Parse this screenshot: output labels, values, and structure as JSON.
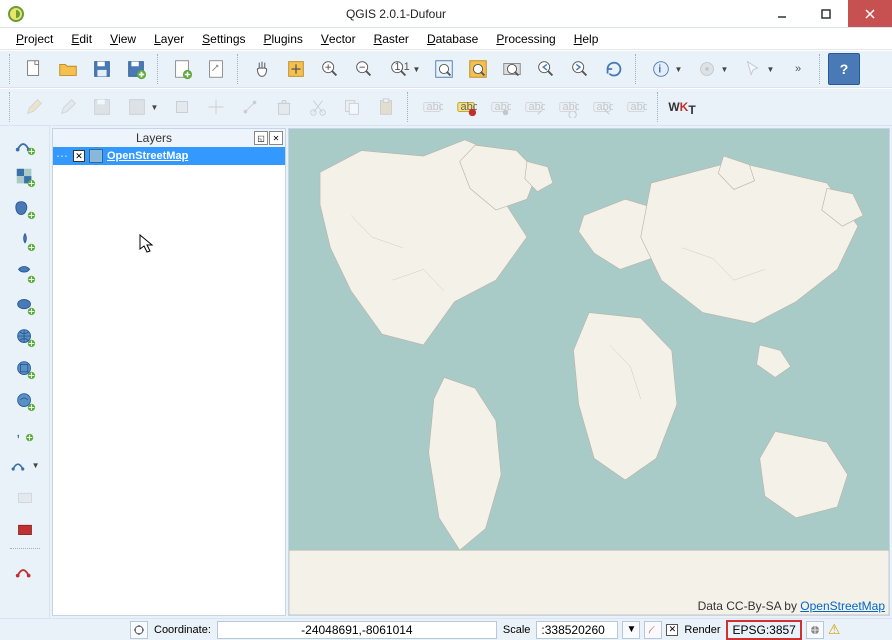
{
  "window": {
    "title": "QGIS 2.0.1-Dufour"
  },
  "menus": [
    "Project",
    "Edit",
    "View",
    "Layer",
    "Settings",
    "Plugins",
    "Vector",
    "Raster",
    "Database",
    "Processing",
    "Help"
  ],
  "layers_panel": {
    "title": "Layers",
    "items": [
      {
        "name": "OpenStreetMap",
        "checked": true
      }
    ]
  },
  "map": {
    "attribution_prefix": "Data CC-By-SA by ",
    "attribution_link": "OpenStreetMap"
  },
  "statusbar": {
    "coord_label": "Coordinate:",
    "coord_value": "-24048691,-8061014",
    "scale_label": "Scale",
    "scale_value": ":338520260",
    "render_label": "Render",
    "epsg_label": "EPSG:3857"
  },
  "toolbar1": {
    "help_tip": "?"
  },
  "wkt_label": "WKT",
  "chevron": "»"
}
